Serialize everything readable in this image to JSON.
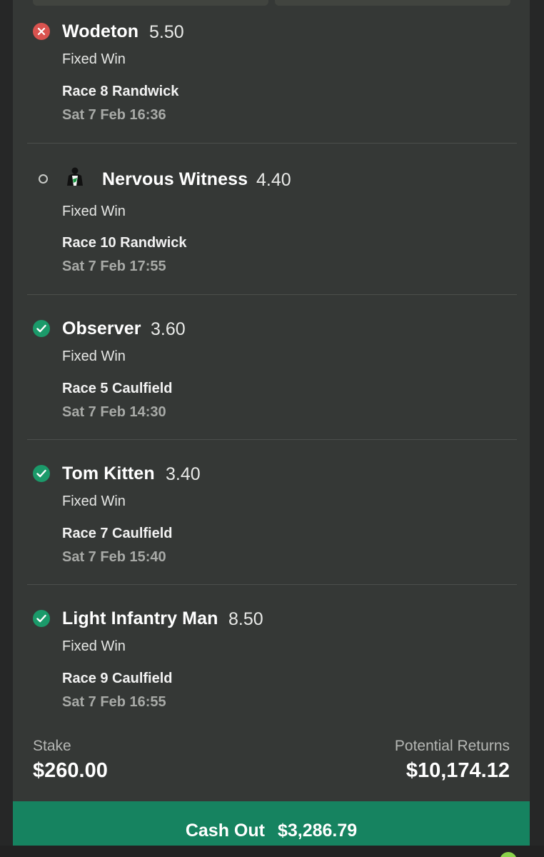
{
  "legs": [
    {
      "status": "lost",
      "runner": "Wodeton",
      "odds": "5.50",
      "bet_type": "Fixed Win",
      "race": "Race 8 Randwick",
      "date": "Sat 7 Feb 16:36"
    },
    {
      "status": "pending",
      "runner": "Nervous Witness",
      "odds": "4.40",
      "bet_type": "Fixed Win",
      "race": "Race 10 Randwick",
      "date": "Sat 7 Feb 17:55"
    },
    {
      "status": "won",
      "runner": "Observer",
      "odds": "3.60",
      "bet_type": "Fixed Win",
      "race": "Race 5 Caulfield",
      "date": "Sat 7 Feb 14:30"
    },
    {
      "status": "won",
      "runner": "Tom Kitten",
      "odds": "3.40",
      "bet_type": "Fixed Win",
      "race": "Race 7 Caulfield",
      "date": "Sat 7 Feb 15:40"
    },
    {
      "status": "won",
      "runner": "Light Infantry Man",
      "odds": "8.50",
      "bet_type": "Fixed Win",
      "race": "Race 9 Caulfield",
      "date": "Sat 7 Feb 16:55"
    }
  ],
  "summary": {
    "stake_label": "Stake",
    "stake_value": "$260.00",
    "returns_label": "Potential Returns",
    "returns_value": "$10,174.12"
  },
  "cashout": {
    "label": "Cash Out",
    "amount": "$3,286.79"
  },
  "colors": {
    "background": "#262727",
    "card": "#353836",
    "won": "#1b9a6a",
    "lost": "#d9534f",
    "cashout": "#168360"
  },
  "icons": {
    "lost": "x-circle-icon",
    "won": "check-circle-icon",
    "pending": "empty-circle-icon",
    "silk": "jockey-silk-icon"
  }
}
